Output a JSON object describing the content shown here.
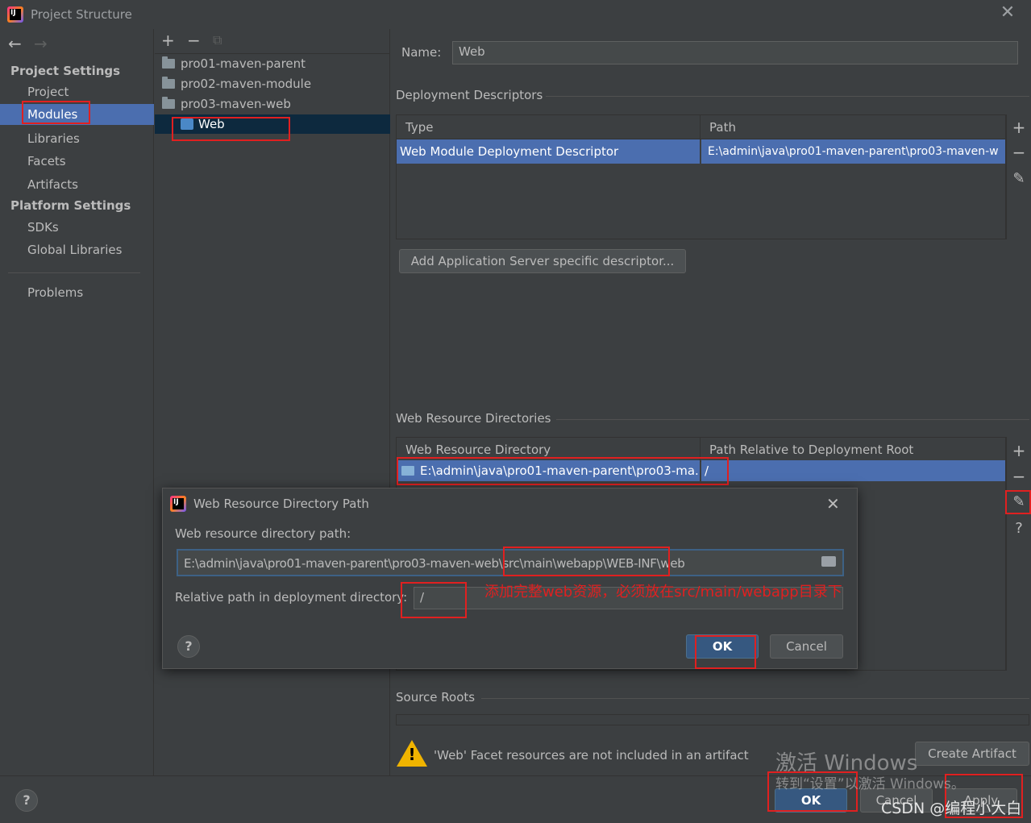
{
  "window": {
    "title": "Project Structure"
  },
  "nav": {
    "project_settings": "Project Settings",
    "platform_settings": "Platform Settings",
    "items": {
      "project": "Project",
      "modules": "Modules",
      "libraries": "Libraries",
      "facets": "Facets",
      "artifacts": "Artifacts",
      "sdks": "SDKs",
      "global_libraries": "Global Libraries",
      "problems": "Problems"
    }
  },
  "tree": {
    "items": [
      "pro01-maven-parent",
      "pro02-maven-module",
      "pro03-maven-web"
    ],
    "selected": "Web"
  },
  "facet": {
    "name_label": "Name:",
    "name_value": "Web",
    "deployment_descriptors": "Deployment Descriptors",
    "dd_columns": [
      "Type",
      "Path"
    ],
    "dd_row": {
      "type": "Web Module Deployment Descriptor",
      "path": "E:\\admin\\java\\pro01-maven-parent\\pro03-maven-w"
    },
    "add_descriptor": "Add Application Server specific descriptor...",
    "web_resource_dirs": "Web Resource Directories",
    "wrd_columns": [
      "Web Resource Directory",
      "Path Relative to Deployment Root"
    ],
    "wrd_row": {
      "dir": "E:\\admin\\java\\pro01-maven-parent\\pro03-ma...",
      "path": "/"
    },
    "source_roots": "Source Roots",
    "warning": "'Web' Facet resources are not included in an artifact",
    "create_artifact": "Create Artifact"
  },
  "dialog": {
    "title": "Web Resource Directory Path",
    "path_label": "Web resource directory path:",
    "path_value": "E:\\admin\\java\\pro01-maven-parent\\pro03-maven-web\\src\\main\\webapp\\WEB-INF\\web",
    "relative_label": "Relative path in deployment directory:",
    "relative_value": "/",
    "annotation": "添加完整web资源，必须放在src/main/webapp目录下",
    "ok": "OK",
    "cancel": "Cancel",
    "help": "?"
  },
  "footer": {
    "help": "?",
    "ok": "OK",
    "cancel": "Cancel",
    "apply": "Apply",
    "watermark_line1": "激活 Windows",
    "watermark_line2": "转到“设置”以激活 Windows。",
    "csdn": "CSDN @编程小大白"
  },
  "colors": {
    "selection": "#4b6eaf",
    "annotation": "#e02020",
    "warning": "#f0b400"
  }
}
